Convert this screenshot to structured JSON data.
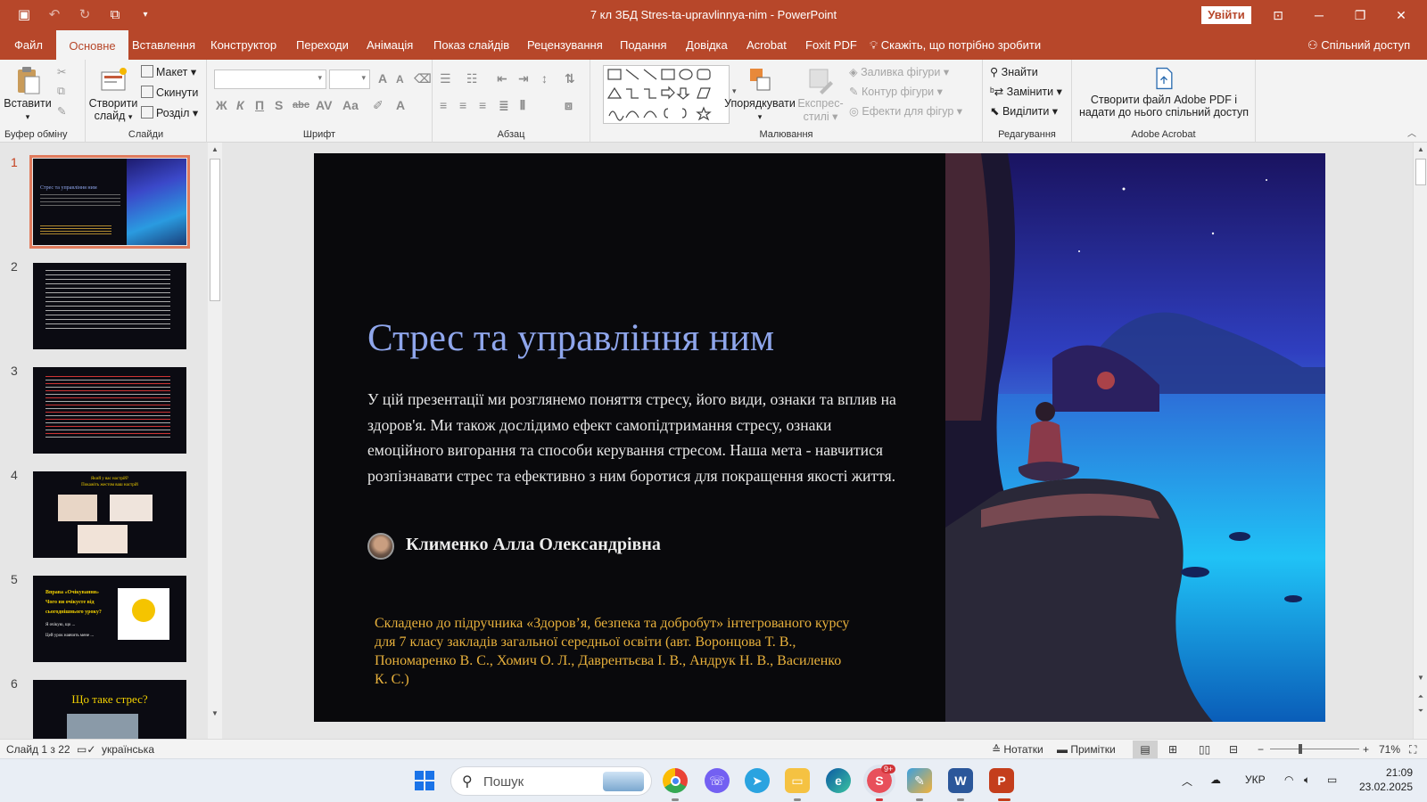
{
  "window": {
    "title": "7 кл ЗБД Stres-ta-upravlinnya-nim  -  PowerPoint",
    "signin_label": "Увійти"
  },
  "tabs": [
    "Файл",
    "Основне",
    "Вставлення",
    "Конструктор",
    "Переходи",
    "Анімація",
    "Показ слайдів",
    "Рецензування",
    "Подання",
    "Довідка",
    "Acrobat",
    "Foxit PDF"
  ],
  "active_tab": "Основне",
  "tell_me": "Скажіть, що потрібно зробити",
  "share": "Спільний доступ",
  "ribbon": {
    "clipboard": {
      "paste": "Вставити",
      "label": "Буфер обміну"
    },
    "slides": {
      "new_slide_1": "Створити",
      "new_slide_2": "слайд",
      "layout": "Макет",
      "reset": "Скинути",
      "section": "Розділ",
      "label": "Слайди"
    },
    "font": {
      "label": "Шрифт"
    },
    "paragraph": {
      "label": "Абзац"
    },
    "drawing": {
      "arrange": "Упорядкувати",
      "quick_styles_1": "Експрес-",
      "quick_styles_2": "стилі",
      "fill": "Заливка фігури",
      "outline": "Контур фігури",
      "effects": "Ефекти для фігур",
      "label": "Малювання"
    },
    "editing": {
      "find": "Знайти",
      "replace": "Замінити",
      "select": "Виділити",
      "label": "Редагування"
    },
    "acrobat": {
      "create_1": "Створити файл Adobe PDF і",
      "create_2": "надати до нього спільний доступ",
      "label": "Adobe Acrobat"
    }
  },
  "thumbnails": {
    "numbers": [
      "1",
      "2",
      "3",
      "4",
      "5",
      "6"
    ],
    "t1_title": "Стрес та управління ним",
    "t4_title_1": "Який у вас настрій?",
    "t4_title_2": "Покажіть жестом ваш настрій",
    "t5_title_1": "Вправа «Очікування»",
    "t5_title_2": "Чого ви очікуєте від",
    "t5_title_3": "сьогоднішнього уроку?",
    "t5_line_1": "Я очікую, що ...",
    "t5_line_2": "Цей урок навчить мене ...",
    "t6_title": "Що таке стрес?"
  },
  "slide": {
    "title": "Стрес та управління ним",
    "body": "У цій презентації ми розглянемо поняття стресу, його види, ознаки та вплив на здоров'я. Ми також дослідимо ефект самопідтримання стресу, ознаки емоційного вигорання та способи керування стресом. Наша мета - навчитися розпізнавати стрес та ефективно з ним боротися для покращення якості життя.",
    "author": "Клименко Алла Олександрівна",
    "credits": "Складено до підручника «Здоров’я, безпека та добробут» інтегрованого курсу для 7 класу закладів загальної середньої освіти (авт. Воронцова Т. В., Пономаренко В. С., Хомич О. Л., Даврентьєва І. В., Андрук Н. В., Василенко К. С.)"
  },
  "status": {
    "slide_of": "Слайд 1 з 22",
    "language": "українська",
    "notes": "Нотатки",
    "comments": "Примітки",
    "zoom": "71%"
  },
  "taskbar": {
    "search_placeholder": "Пошук",
    "badge": "9+",
    "lang": "УКР",
    "time": "21:09",
    "date": "23.02.2025"
  },
  "colors": {
    "accent": "#b7472a",
    "slide_title": "#8fa6ec",
    "credits": "#e8b13c"
  }
}
